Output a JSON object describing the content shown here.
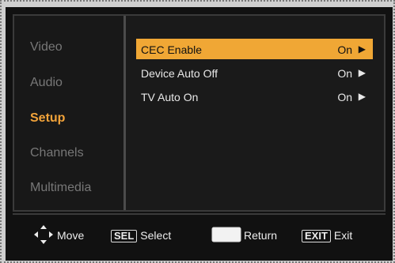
{
  "sidebar": {
    "items": [
      {
        "label": "Video"
      },
      {
        "label": "Audio"
      },
      {
        "label": "Setup"
      },
      {
        "label": "Channels"
      },
      {
        "label": "Multimedia"
      }
    ],
    "active": "Setup"
  },
  "main": {
    "rows": [
      {
        "label": "CEC Enable",
        "value": "On",
        "arrow": "▶"
      },
      {
        "label": "Device Auto Off",
        "value": "On",
        "arrow": "▶"
      },
      {
        "label": "TV Auto On",
        "value": "On",
        "arrow": "▶"
      }
    ]
  },
  "footer": {
    "move": {
      "label": "Move"
    },
    "select": {
      "key": "SEL",
      "label": "Select"
    },
    "return": {
      "label": "Return"
    },
    "exit": {
      "key": "EXIT",
      "label": "Exit"
    }
  },
  "colors": {
    "accent": "#f0a735",
    "background": "#111111",
    "inactive_text": "#777777",
    "active_text": "#f2a33a"
  },
  "icons": {
    "move": "four-way-arrow-icon",
    "return": "return-button-icon"
  }
}
